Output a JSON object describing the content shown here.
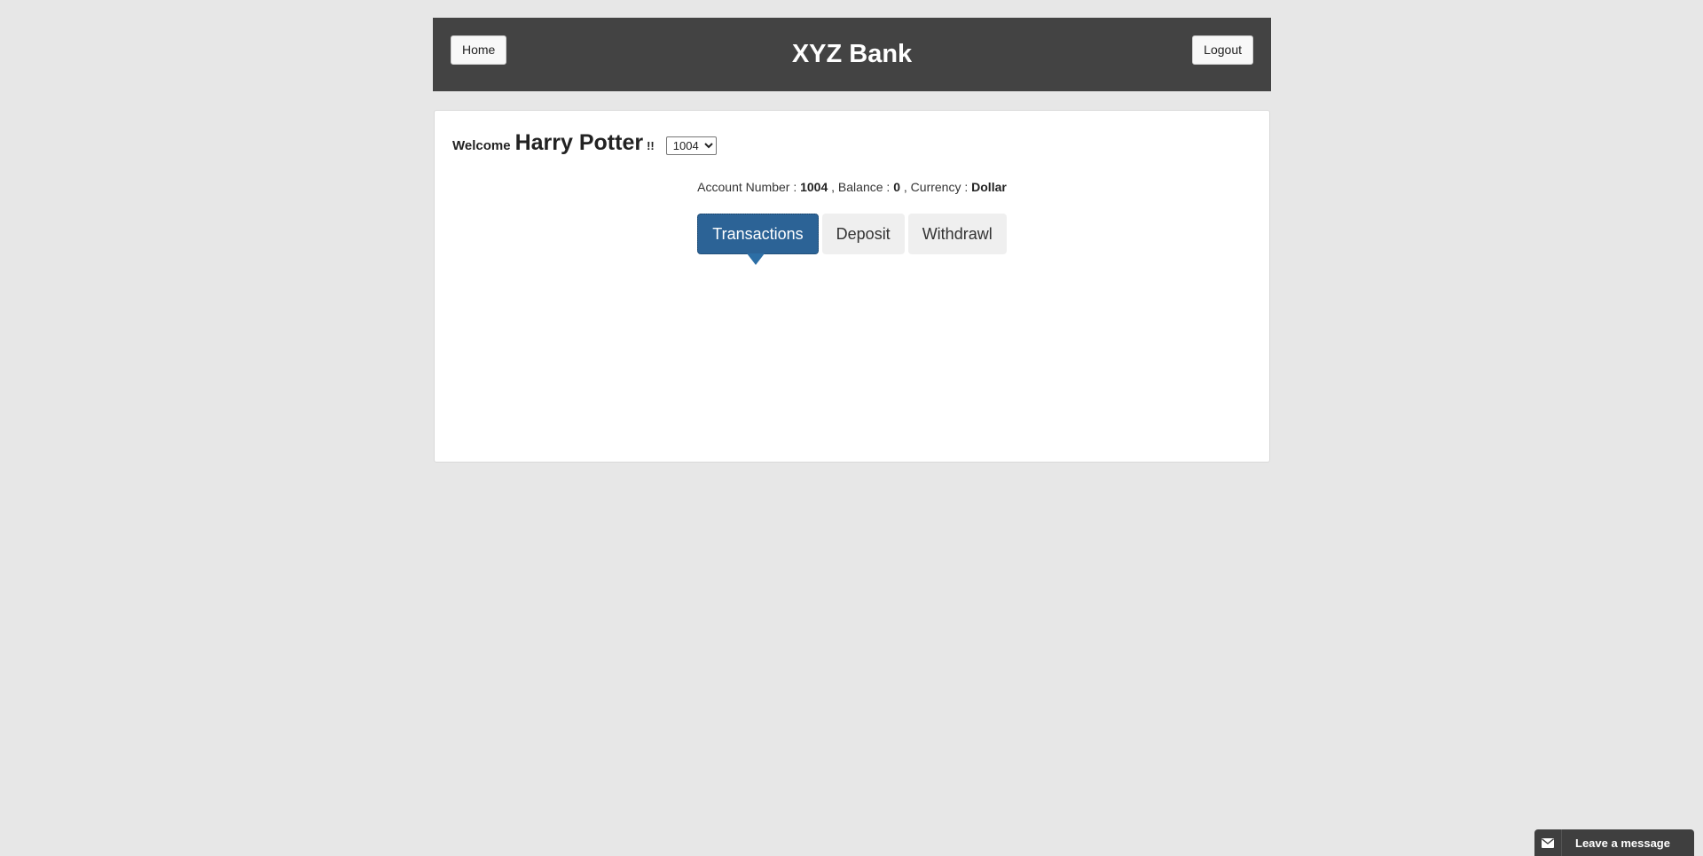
{
  "header": {
    "title": "XYZ Bank",
    "home_label": "Home",
    "logout_label": "Logout"
  },
  "customer": {
    "welcome_text": "Welcome",
    "name": "Harry Potter",
    "exclamation": "!!",
    "selected_account": "1004",
    "account_options": [
      "1004"
    ]
  },
  "account_info": {
    "account_number_label": "Account Number :",
    "account_number": "1004",
    "balance_label": ", Balance :",
    "balance": "0",
    "currency_label": ", Currency :",
    "currency": "Dollar"
  },
  "tabs": [
    {
      "label": "Transactions",
      "active": true
    },
    {
      "label": "Deposit",
      "active": false
    },
    {
      "label": "Withdrawl",
      "active": false
    }
  ],
  "chat_widget": {
    "label": "Leave a message",
    "icon": "envelope-icon"
  },
  "colors": {
    "background": "#e7e7e7",
    "header": "#434343",
    "active_tab": "#2c6396",
    "tab": "#efefef"
  }
}
